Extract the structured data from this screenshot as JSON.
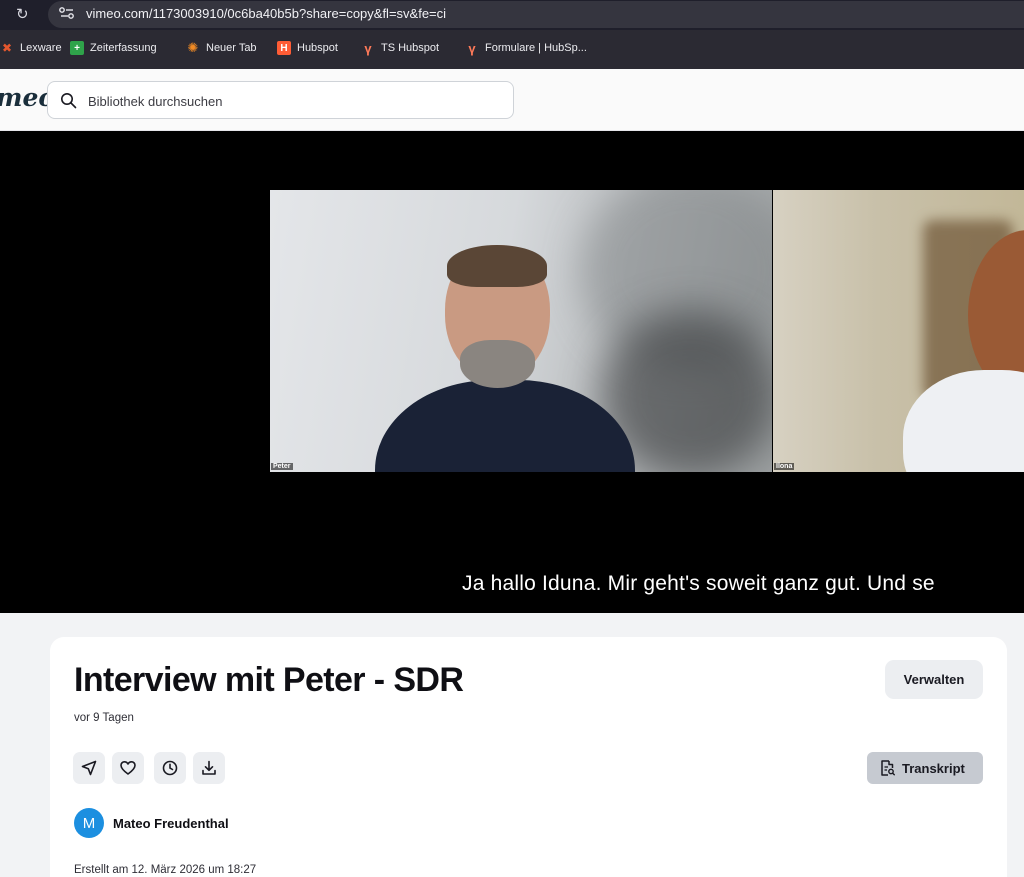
{
  "browser": {
    "url": "vimeo.com/1173003910/0c6ba40b5b?share=copy&fl=sv&fe=ci",
    "bookmarks": [
      {
        "label": "Lexware",
        "icon": "lexware-icon",
        "color": "#e4572e"
      },
      {
        "label": "Zeiterfassung",
        "icon": "zeiterfassung-icon",
        "color": "#2fa34a"
      },
      {
        "label": "Neuer Tab",
        "icon": "neuer-tab-icon",
        "color": "#f08a24"
      },
      {
        "label": "Hubspot",
        "icon": "hubspot-icon",
        "color": "#ff5c35"
      },
      {
        "label": "TS Hubspot",
        "icon": "hubspot-icon",
        "color": "#ff7a59"
      },
      {
        "label": "Formulare | HubSp...",
        "icon": "hubspot-icon",
        "color": "#ff7a59"
      }
    ]
  },
  "header": {
    "logo": "meo",
    "search_placeholder": "Bibliothek durchsuchen"
  },
  "player": {
    "participants": [
      {
        "name": "Peter"
      },
      {
        "name": "Ilona"
      }
    ],
    "subtitle": "Ja hallo Iduna. Mir geht's soweit ganz gut. Und se"
  },
  "video": {
    "title": "Interview mit Peter - SDR",
    "relative_date": "vor 9 Tagen",
    "manage_label": "Verwalten",
    "transcript_label": "Transkript",
    "actions": [
      "send-icon",
      "heart-icon",
      "clock-icon",
      "download-icon"
    ],
    "owner": {
      "initial": "M",
      "name": "Mateo Freudenthal",
      "avatar_color": "#1c8fe0"
    },
    "created": "Erstellt am 12. März 2026 um 18:27"
  }
}
